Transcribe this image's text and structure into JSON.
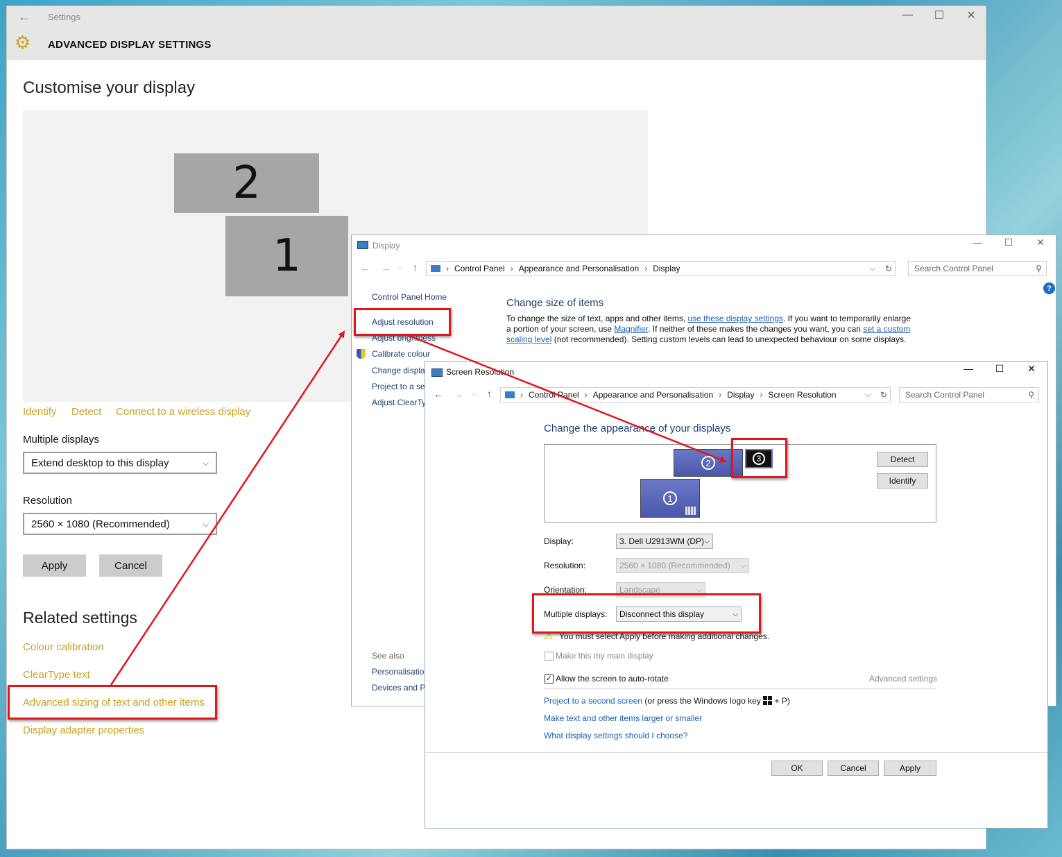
{
  "settings": {
    "window_title": "Settings",
    "page_heading": "ADVANCED DISPLAY SETTINGS",
    "title": "Customise your display",
    "monitors": [
      "2",
      "1"
    ],
    "links": [
      "Identify",
      "Detect",
      "Connect to a wireless display"
    ],
    "multiple_displays_label": "Multiple displays",
    "multiple_displays_value": "Extend desktop to this display",
    "resolution_label": "Resolution",
    "resolution_value": "2560 × 1080 (Recommended)",
    "apply_label": "Apply",
    "cancel_label": "Cancel",
    "related_heading": "Related settings",
    "related_links": [
      "Colour calibration",
      "ClearType text",
      "Advanced sizing of text and other items",
      "Display adapter properties"
    ]
  },
  "display_window": {
    "title": "Display",
    "breadcrumb": [
      "Control Panel",
      "Appearance and Personalisation",
      "Display"
    ],
    "search_placeholder": "Search Control Panel",
    "sidebar": [
      "Control Panel Home",
      "Adjust resolution",
      "Adjust brightness",
      "Calibrate colour",
      "Change displa",
      "Project to a se",
      "Adjust ClearTy"
    ],
    "see_also_label": "See also",
    "see_also": [
      "Personalisation",
      "Devices and Pr"
    ],
    "heading": "Change size of items",
    "desc_1": "To change the size of text, apps and other items, ",
    "desc_link_1": "use these display settings",
    "desc_2": ". If you want to temporarily enlarge",
    "desc_3": "a portion of your screen, use ",
    "desc_link_2": "Magnifier",
    "desc_4": ". If neither of these makes the changes you want, you can ",
    "desc_link_3a": "set a custom",
    "desc_link_3b": "scaling level",
    "desc_5": " (not recommended). Setting custom levels can lead to unexpected behaviour on some displays."
  },
  "screen_resolution": {
    "title": "Screen Resolution",
    "breadcrumb": [
      "Control Panel",
      "Appearance and Personalisation",
      "Display",
      "Screen Resolution"
    ],
    "search_placeholder": "Search Control Panel",
    "heading": "Change the appearance of your displays",
    "monitors": [
      "2",
      "3",
      "1"
    ],
    "detect_label": "Detect",
    "identify_label": "Identify",
    "display_label": "Display:",
    "display_value": "3. Dell U2913WM (DP)",
    "resolution_label": "Resolution:",
    "resolution_value": "2560 × 1080 (Recommended)",
    "orientation_label": "Orientation:",
    "orientation_value": "Landscape",
    "multiple_label": "Multiple displays:",
    "multiple_value": "Disconnect this display",
    "warning": "You must select Apply before making additional changes.",
    "main_display_label": "Make this my main display",
    "auto_rotate_label": "Allow the screen to auto-rotate",
    "advanced_label": "Advanced settings",
    "project_link": "Project to a second screen",
    "project_suffix_1": " (or press the Windows logo key ",
    "project_suffix_2": " + P)",
    "larger_link": "Make text and other items larger or smaller",
    "choose_link": "What display settings should I choose?",
    "ok_label": "OK",
    "cancel_label": "Cancel",
    "apply_label": "Apply"
  },
  "colors": {
    "accent_link": "#c8a21e",
    "annotation": "#e0161b",
    "cp_heading": "#1e3f72"
  }
}
